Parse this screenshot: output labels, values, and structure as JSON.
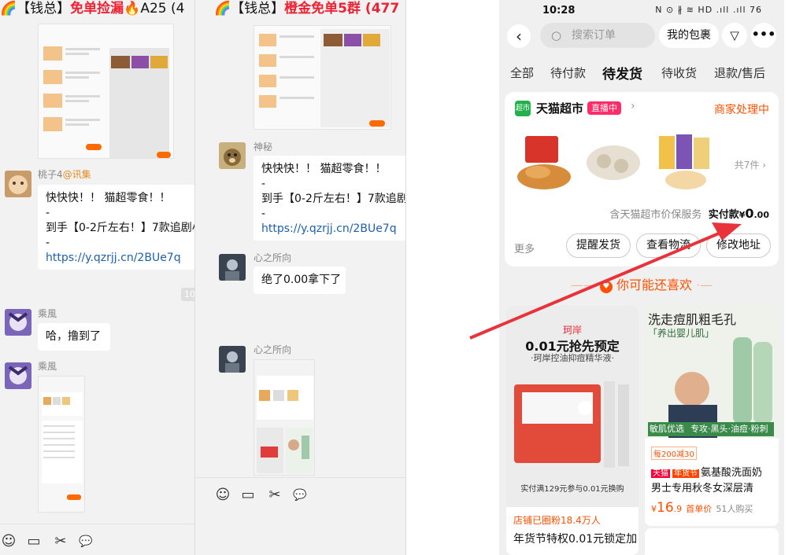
{
  "window1": {
    "title_prefix": "🌈【钱总】",
    "title_rest": "免单捡漏",
    "title_suffix": "🔥A25 (4",
    "messages": [
      {
        "name": "桃子4",
        "name_at": "@讯集",
        "line1": "快快快！！ 猫超零食！！",
        "dash1": "-",
        "line2": "到手【0-2斤左右！】7款追剧小",
        "dash2": "-",
        "link": "https://y.qzrjj.cn/2BUe7q"
      },
      {
        "name": "乘風",
        "text": "哈，撸到了"
      },
      {
        "name": "乘風"
      }
    ],
    "timestamp": "10"
  },
  "window2": {
    "title_prefix": "🌈【钱总】",
    "title_rest": "橙金免单5群 (477",
    "messages": [
      {
        "name": "神秘",
        "line1": "快快快！！ 猫超零食！！",
        "dash1": "-",
        "line2": "到手【0-2斤左右！】7款追剧",
        "dash2": "-",
        "link": "https://y.qzrjj.cn/2BUe7q"
      },
      {
        "name": "心之所向",
        "text": "绝了0.00拿下了"
      },
      {
        "name": "心之所向"
      }
    ]
  },
  "toolbar": {
    "emoji": "☺",
    "folder": "▭",
    "scissors": "✂",
    "chat": "💬"
  },
  "phone": {
    "time": "10:28",
    "status_icons": "N ⊙ ∦ ≋ HD .ıll .ıll 76",
    "search_placeholder": "搜索订单",
    "my_package": "我的包裹",
    "tabs": [
      "全部",
      "待付款",
      "待发货",
      "待收货",
      "退款/售后"
    ],
    "active_tab_index": 2,
    "shop_logo": "超市",
    "shop_name": "天猫超市",
    "live_badge": "直播中",
    "order_state": "商家处理中",
    "item_count": "共7件",
    "protection": "含天猫超市价保服务",
    "paid_label": "实付款",
    "paid_currency": "¥",
    "paid_int": "0",
    "paid_dec": ".00",
    "more_label": "更多",
    "buttons": [
      "提醒发货",
      "查看物流",
      "修改地址"
    ],
    "you_may_like": "你可能还喜欢",
    "rec1": {
      "brand": "珂岸",
      "headline": "0.01元抢先预定",
      "sub": "·珂岸控油抑痘精华液·",
      "bottom": "实付满129元参与0.01元换购",
      "fans": "店铺已圈粉18.4万人",
      "title": "年货节特权0.01元锁定加"
    },
    "rec2": {
      "headline": "洗走痘肌粗毛孔",
      "sub": "「养出婴儿肌」",
      "tags": "敏肌优选",
      "tags2": "专攻·黑头·油痘·粉刺",
      "promo": "每200减30",
      "badge1": "天猫",
      "badge2": "年货节",
      "title1": "氨基酸洗面奶",
      "title2": "男士专用秋冬女深层清",
      "price_currency": "¥",
      "price": "16",
      "price_dec": ".9",
      "price_label": "首单价",
      "buyers": "51人购买"
    }
  },
  "colors": {
    "accent": "#ff5000",
    "arrow": "#e8333a",
    "link": "#1d5fb0"
  }
}
